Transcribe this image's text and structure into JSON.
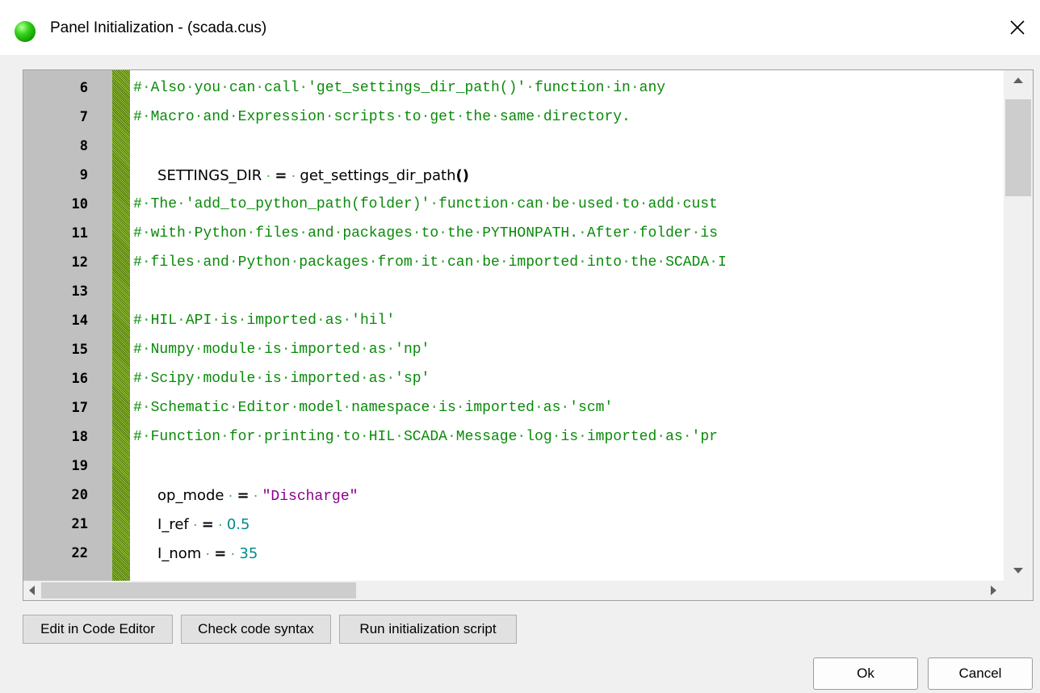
{
  "window": {
    "title": "Panel Initialization - (scada.cus)",
    "close_label": "×"
  },
  "editor": {
    "lines": [
      {
        "no": "6"
      },
      {
        "no": "7"
      },
      {
        "no": "8"
      },
      {
        "no": "9"
      },
      {
        "no": "10"
      },
      {
        "no": "11"
      },
      {
        "no": "12"
      },
      {
        "no": "13"
      },
      {
        "no": "14"
      },
      {
        "no": "15"
      },
      {
        "no": "16"
      },
      {
        "no": "17"
      },
      {
        "no": "18"
      },
      {
        "no": "19"
      },
      {
        "no": "20"
      },
      {
        "no": "21"
      },
      {
        "no": "22"
      }
    ],
    "code": {
      "l6": "# Also you can call 'get_settings_dir_path()' function in any",
      "l7": "# Macro and Expression scripts to get the same directory.",
      "l8_name": "SETTINGS_DIR",
      "l8_op": "=",
      "l8_value": "get_settings_dir_path",
      "l8_parens": "()",
      "l10": "# The 'add_to_python_path(folder)' function can be used to add cust",
      "l11": "# with Python files and packages to the PYTHONPATH. After folder is",
      "l12": "# files and Python packages from it can be imported into the SCADA I",
      "l14": "# HIL API is imported as 'hil'",
      "l15": "# Numpy module is imported as 'np'",
      "l16": "# Scipy module is imported as 'sp'",
      "l17": "# Schematic Editor model namespace is imported as 'scm'",
      "l18": "# Function for printing to HIL SCADA Message log is imported as 'pr",
      "l19_name": "op_mode",
      "l19_op": "=",
      "l19_value": "\"Discharge\"",
      "l20_name": "I_ref",
      "l20_op": "=",
      "l20_value": "0.5",
      "l21_name": "I_nom",
      "l21_op": "=",
      "l21_value": "35"
    }
  },
  "buttons": {
    "edit_in_code_editor": "Edit in Code Editor",
    "check_code_syntax": "Check code syntax",
    "run_initialization_script": "Run initialization script",
    "ok": "Ok",
    "cancel": "Cancel"
  },
  "colors": {
    "comment": "#0a8a0a",
    "string": "#8b008b",
    "number": "#008b8b",
    "gutter": "#c0c0c0",
    "fold_margin": "#6b8e23"
  }
}
